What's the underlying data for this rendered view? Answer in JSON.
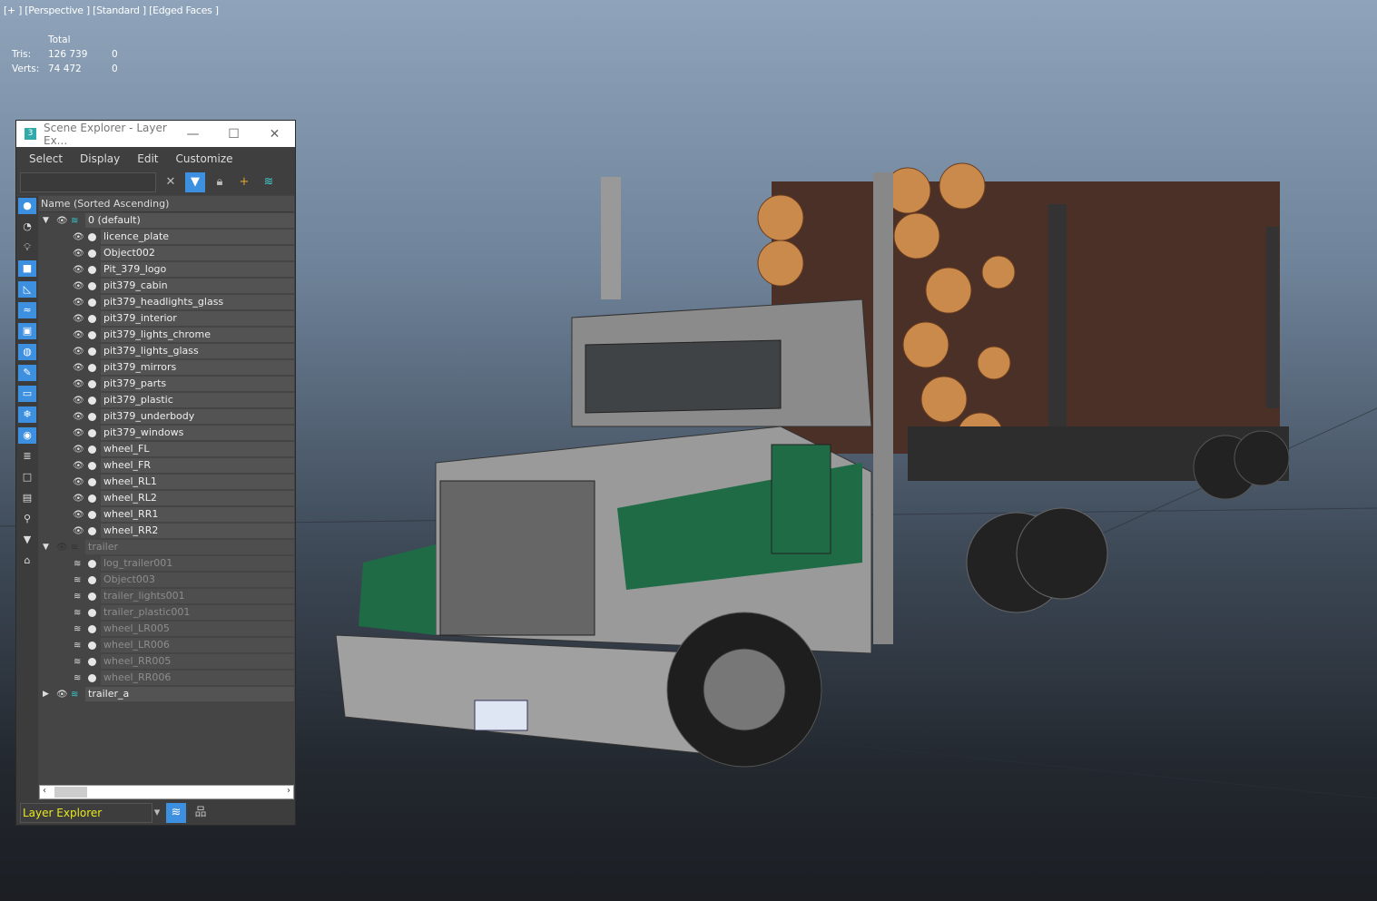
{
  "viewport": {
    "label": "[+ ] [Perspective ] [Standard ] [Edged Faces ]",
    "stats": {
      "header": "Total",
      "tris_label": "Tris:",
      "tris_value": "126 739",
      "tris_sel": "0",
      "verts_label": "Verts:",
      "verts_value": "74 472",
      "verts_sel": "0"
    }
  },
  "window": {
    "title": "Scene Explorer - Layer Ex...",
    "icon": "3",
    "minimize": "—",
    "maximize": "☐",
    "close": "✕"
  },
  "menu": [
    "Select",
    "Display",
    "Edit",
    "Customize"
  ],
  "search": {
    "value": "",
    "placeholder": ""
  },
  "column_header": "Name (Sorted Ascending)",
  "tree": [
    {
      "label": "0 (default)",
      "level": 0,
      "type": "layer",
      "expanded": true,
      "dim": false
    },
    {
      "label": "licence_plate",
      "level": 1,
      "type": "object",
      "dim": false
    },
    {
      "label": "Object002",
      "level": 1,
      "type": "object",
      "dim": false
    },
    {
      "label": "Pit_379_logo",
      "level": 1,
      "type": "object",
      "dim": false
    },
    {
      "label": "pit379_cabin",
      "level": 1,
      "type": "object",
      "dim": false
    },
    {
      "label": "pit379_headlights_glass",
      "level": 1,
      "type": "object",
      "dim": false
    },
    {
      "label": "pit379_interior",
      "level": 1,
      "type": "object",
      "dim": false
    },
    {
      "label": "pit379_lights_chrome",
      "level": 1,
      "type": "object",
      "dim": false
    },
    {
      "label": "pit379_lights_glass",
      "level": 1,
      "type": "object",
      "dim": false
    },
    {
      "label": "pit379_mirrors",
      "level": 1,
      "type": "object",
      "dim": false
    },
    {
      "label": "pit379_parts",
      "level": 1,
      "type": "object",
      "dim": false
    },
    {
      "label": "pit379_plastic",
      "level": 1,
      "type": "object",
      "dim": false
    },
    {
      "label": "pit379_underbody",
      "level": 1,
      "type": "object",
      "dim": false
    },
    {
      "label": "pit379_windows",
      "level": 1,
      "type": "object",
      "dim": false
    },
    {
      "label": "wheel_FL",
      "level": 1,
      "type": "object",
      "dim": false
    },
    {
      "label": "wheel_FR",
      "level": 1,
      "type": "object",
      "dim": false
    },
    {
      "label": "wheel_RL1",
      "level": 1,
      "type": "object",
      "dim": false
    },
    {
      "label": "wheel_RL2",
      "level": 1,
      "type": "object",
      "dim": false
    },
    {
      "label": "wheel_RR1",
      "level": 1,
      "type": "object",
      "dim": false
    },
    {
      "label": "wheel_RR2",
      "level": 1,
      "type": "object",
      "dim": false
    },
    {
      "label": "trailer",
      "level": 0,
      "type": "layer",
      "expanded": true,
      "dim": true
    },
    {
      "label": "log_trailer001",
      "level": 1,
      "type": "object",
      "dim": true
    },
    {
      "label": "Object003",
      "level": 1,
      "type": "object",
      "dim": true
    },
    {
      "label": "trailer_lights001",
      "level": 1,
      "type": "object",
      "dim": true
    },
    {
      "label": "trailer_plastic001",
      "level": 1,
      "type": "object",
      "dim": true
    },
    {
      "label": "wheel_LR005",
      "level": 1,
      "type": "object",
      "dim": true
    },
    {
      "label": "wheel_LR006",
      "level": 1,
      "type": "object",
      "dim": true
    },
    {
      "label": "wheel_RR005",
      "level": 1,
      "type": "object",
      "dim": true
    },
    {
      "label": "wheel_RR006",
      "level": 1,
      "type": "object",
      "dim": true
    },
    {
      "label": "trailer_a",
      "level": 0,
      "type": "layer",
      "expanded": false,
      "dim": false
    }
  ],
  "explorer_select": "Layer Explorer",
  "colors": {
    "accent": "#3d8fe0",
    "explorer_text": "#e8e820"
  }
}
